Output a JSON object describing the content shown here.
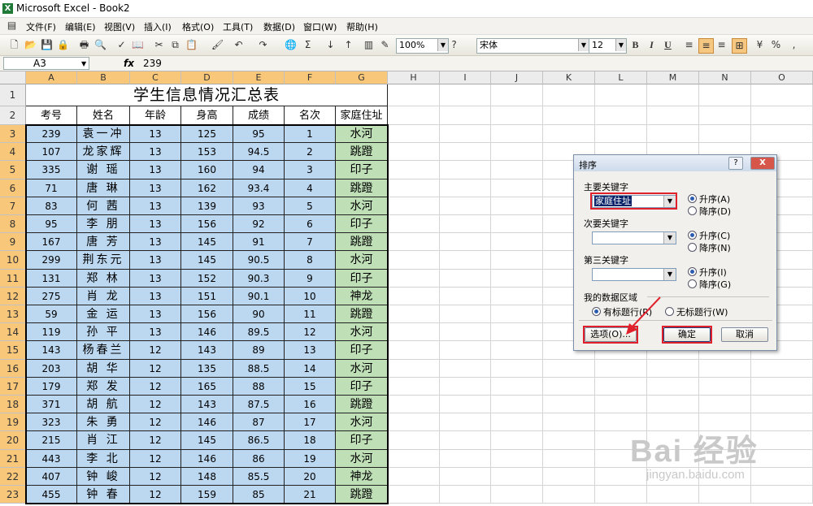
{
  "window": {
    "title": "Microsoft Excel - Book2"
  },
  "menu": [
    "文件(F)",
    "编辑(E)",
    "视图(V)",
    "插入(I)",
    "格式(O)",
    "工具(T)",
    "数据(D)",
    "窗口(W)",
    "帮助(H)"
  ],
  "toolbar": {
    "zoom": "100%",
    "font": "宋体",
    "size": "12",
    "bold": "B",
    "italic": "I",
    "underline": "U",
    "percent": "%",
    "comma": ","
  },
  "formula_bar": {
    "name_box": "A3",
    "fx": "fx",
    "value": "239"
  },
  "columns": [
    "A",
    "B",
    "C",
    "D",
    "E",
    "F",
    "G",
    "H",
    "I",
    "J",
    "K",
    "L",
    "M",
    "N",
    "O"
  ],
  "rows": [
    "1",
    "2",
    "3",
    "4",
    "5",
    "6",
    "7",
    "8",
    "9",
    "10",
    "11",
    "12",
    "13",
    "14",
    "15",
    "16",
    "17",
    "18",
    "19",
    "20",
    "21",
    "22",
    "23"
  ],
  "sheet": {
    "title": "学生信息情况汇总表",
    "headers": [
      "考号",
      "姓名",
      "年龄",
      "身高",
      "成绩",
      "名次",
      "家庭住址"
    ],
    "records": [
      [
        "239",
        "袁一冲",
        "13",
        "125",
        "95",
        "1",
        "水河"
      ],
      [
        "107",
        "龙家辉",
        "13",
        "153",
        "94.5",
        "2",
        "跳蹬"
      ],
      [
        "335",
        "谢 瑶",
        "13",
        "160",
        "94",
        "3",
        "印子"
      ],
      [
        "71",
        "唐 琳",
        "13",
        "162",
        "93.4",
        "4",
        "跳蹬"
      ],
      [
        "83",
        "何 茜",
        "13",
        "139",
        "93",
        "5",
        "水河"
      ],
      [
        "95",
        "李 朋",
        "13",
        "156",
        "92",
        "6",
        "印子"
      ],
      [
        "167",
        "唐 芳",
        "13",
        "145",
        "91",
        "7",
        "跳蹬"
      ],
      [
        "299",
        "荆东元",
        "13",
        "145",
        "90.5",
        "8",
        "水河"
      ],
      [
        "131",
        "郑 林",
        "13",
        "152",
        "90.3",
        "9",
        "印子"
      ],
      [
        "275",
        "肖 龙",
        "13",
        "151",
        "90.1",
        "10",
        "神龙"
      ],
      [
        "59",
        "金 运",
        "13",
        "156",
        "90",
        "11",
        "跳蹬"
      ],
      [
        "119",
        "孙 平",
        "13",
        "146",
        "89.5",
        "12",
        "水河"
      ],
      [
        "143",
        "杨春兰",
        "12",
        "143",
        "89",
        "13",
        "印子"
      ],
      [
        "203",
        "胡 华",
        "12",
        "135",
        "88.5",
        "14",
        "水河"
      ],
      [
        "179",
        "郑 发",
        "12",
        "165",
        "88",
        "15",
        "印子"
      ],
      [
        "371",
        "胡 航",
        "12",
        "143",
        "87.5",
        "16",
        "跳蹬"
      ],
      [
        "323",
        "朱 勇",
        "12",
        "146",
        "87",
        "17",
        "水河"
      ],
      [
        "215",
        "肖 江",
        "12",
        "145",
        "86.5",
        "18",
        "印子"
      ],
      [
        "443",
        "李 北",
        "12",
        "146",
        "86",
        "19",
        "水河"
      ],
      [
        "407",
        "钟 峻",
        "12",
        "148",
        "85.5",
        "20",
        "神龙"
      ],
      [
        "455",
        "钟 春",
        "12",
        "159",
        "85",
        "21",
        "跳蹬"
      ]
    ]
  },
  "sort_dialog": {
    "title": "排序",
    "help": "?",
    "close": "X",
    "primary_label": "主要关键字",
    "primary_value": "家庭住址",
    "secondary_label": "次要关键字",
    "secondary_value": "",
    "third_label": "第三关键字",
    "third_value": "",
    "asc_a": "升序(A)",
    "desc_d": "降序(D)",
    "asc_c": "升序(C)",
    "desc_n": "降序(N)",
    "asc_i": "升序(I)",
    "desc_g": "降序(G)",
    "range_label": "我的数据区域",
    "has_header": "有标题行(R)",
    "no_header": "无标题行(W)",
    "options": "选项(O)...",
    "ok": "确定",
    "cancel": "取消"
  },
  "watermark": {
    "brand": "Bai 经验",
    "url": "jingyan.baidu.com"
  },
  "colors": {
    "selected_header": "#f8c77a",
    "blue_fill": "#bcd8f1",
    "green_fill": "#bfdfb7",
    "highlight": "#e0202a"
  }
}
